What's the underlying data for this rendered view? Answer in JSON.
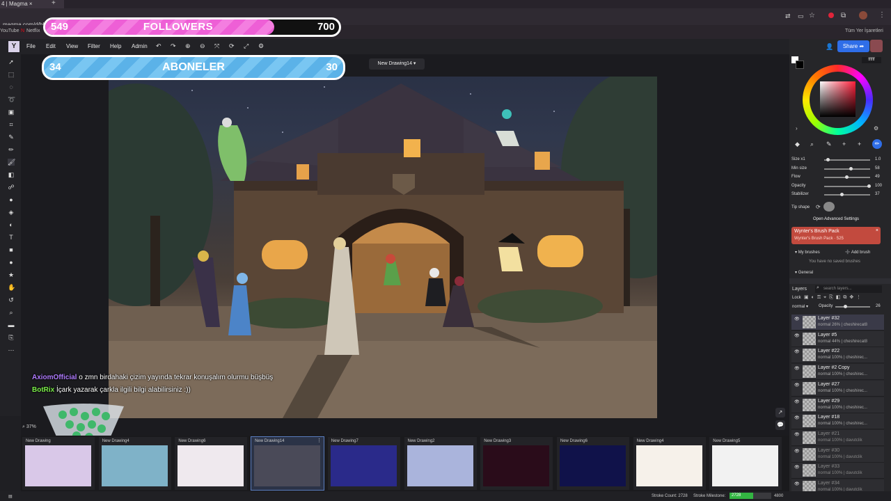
{
  "browser": {
    "tab_title": "4 | Magma",
    "url": "magma.com/d/bHtZ8Q4t4e",
    "bookmarks": [
      "YouTube",
      "Netflix"
    ],
    "bookmarks_right": "Tüm Yer İşaretleri"
  },
  "overlays": {
    "followers": {
      "current": "549",
      "label": "FOLLOWERS",
      "goal": "700",
      "progress": 0.78
    },
    "aboneler": {
      "current": "34",
      "label": "ABONELER",
      "goal": "30",
      "progress": 1.0
    }
  },
  "app": {
    "logo": "Y",
    "menu": [
      "File",
      "Edit",
      "View",
      "Filter",
      "Help",
      "Admin"
    ],
    "share_label": "Share",
    "document_tab": "New Drawing14",
    "zoom": "37%"
  },
  "chat": [
    {
      "user": "AxiomOfficial",
      "color": "#b07cff",
      "message": "o zmn birdahaki çizim yayında tekrar konuşalım olurmu büşbüş"
    },
    {
      "user": "BotRix",
      "color": "#7cf04a",
      "message": "İçark yazarak çarkla ilgili bilgi alabilirsiniz :))"
    }
  ],
  "color_panel": {
    "hex": "ffffff",
    "accent": "#ff1f3a"
  },
  "brush_settings": [
    {
      "label": "Size x1",
      "value": "1.0",
      "level": 0.05
    },
    {
      "label": "Min size",
      "value": "58",
      "level": 0.58
    },
    {
      "label": "Flow",
      "value": "49",
      "level": 0.49
    },
    {
      "label": "Opacity",
      "value": "100",
      "level": 1.0
    },
    {
      "label": "Stabilizer",
      "value": "37",
      "level": 0.37
    }
  ],
  "tip_shape_label": "Tip shape",
  "advanced_label": "Open Advanced Settings",
  "brush_pack": {
    "title": "Wynter's Brush Pack",
    "subtitle": "Wynter's Brush Pack · 525"
  },
  "my_brushes": {
    "label": "My brushes",
    "add": "Add brush",
    "empty": "You have no saved brushes"
  },
  "general_label": "General",
  "layers_panel": {
    "title": "Layers",
    "search_placeholder": "search layers...",
    "lock_label": "Lock",
    "blend": "normal",
    "opacity_label": "Opacity",
    "opacity_value": "26",
    "layers": [
      {
        "name": "Layer #32",
        "sub": "normal 26% | cheshirecat8",
        "selected": true,
        "dim": false
      },
      {
        "name": "Layer #5",
        "sub": "normal 44% | cheshirecat8",
        "selected": false,
        "dim": false
      },
      {
        "name": "Layer #22",
        "sub": "normal 100% | cheshirec...",
        "selected": false,
        "dim": false
      },
      {
        "name": "Layer #2 Copy",
        "sub": "normal 100% | cheshirec...",
        "selected": false,
        "dim": false
      },
      {
        "name": "Layer #27",
        "sub": "normal 100% | cheshirec...",
        "selected": false,
        "dim": false
      },
      {
        "name": "Layer #29",
        "sub": "normal 100% | cheshirec...",
        "selected": false,
        "dim": false
      },
      {
        "name": "Layer #18",
        "sub": "normal 100% | cheshirec...",
        "selected": false,
        "dim": false
      },
      {
        "name": "Layer #21",
        "sub": "normal 100% | davutclik",
        "selected": false,
        "dim": true
      },
      {
        "name": "Layer #30",
        "sub": "normal 100% | davutclik",
        "selected": false,
        "dim": true
      },
      {
        "name": "Layer #33",
        "sub": "normal 100% | davutclik",
        "selected": false,
        "dim": true
      },
      {
        "name": "Layer #34",
        "sub": "normal 100% | davutclik",
        "selected": false,
        "dim": true
      }
    ]
  },
  "filmstrip": [
    {
      "name": "New Drawing",
      "bg": "#d9c8e8"
    },
    {
      "name": "New Drawing4",
      "bg": "#7fb2c8"
    },
    {
      "name": "New Drawing6",
      "bg": "#efe9ee"
    },
    {
      "name": "New Drawing14",
      "bg": "#4a4a58",
      "selected": true
    },
    {
      "name": "New Drawing7",
      "bg": "#2a2a8a"
    },
    {
      "name": "New Drawing2",
      "bg": "#aab4dc"
    },
    {
      "name": "New Drawing3",
      "bg": "#2a0c1a"
    },
    {
      "name": "New Drawing6",
      "bg": "#10124a"
    },
    {
      "name": "New Drawing4",
      "bg": "#f6f1ea"
    },
    {
      "name": "New Drawing5",
      "bg": "#f2f2f2"
    }
  ],
  "status": {
    "stroke_count": "Stroke Count: 2728",
    "stroke_milestone": "Stroke Milestone:",
    "milestone_value": "2728",
    "milestone_goal": "4800"
  }
}
